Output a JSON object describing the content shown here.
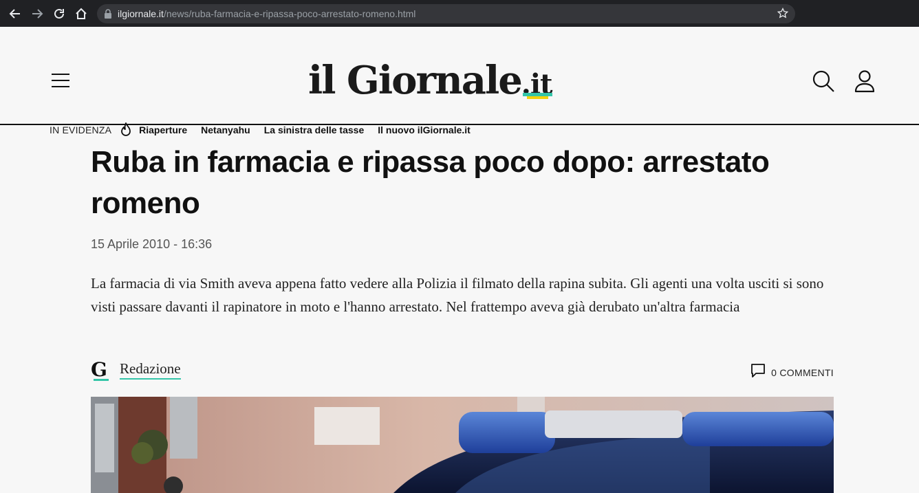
{
  "browser": {
    "url_host": "ilgiornale.it",
    "url_path": "/news/ruba-farmacia-e-ripassa-poco-arrestato-romeno.html"
  },
  "header": {
    "logo_main": "il Giornale",
    "logo_tld": ".it",
    "evidenza_label": "IN EVIDENZA",
    "evidenza_links": [
      "Riaperture",
      "Netanyahu",
      "La sinistra delle tasse",
      "Il nuovo ilGiornale.it"
    ]
  },
  "article": {
    "title": "Ruba in farmacia e ripassa poco dopo: arrestato romeno",
    "date": "15 Aprile 2010 - 16:36",
    "lead": "La farmacia di via Smith aveva appena fatto vedere alla Polizia il filmato della rapina subita. Gli agenti una volta usciti si sono visti passare davanti il rapinatore in moto e l'hanno arrestato. Nel frattempo aveva già derubato un'altra farmacia",
    "author_initial": "G",
    "author": "Redazione",
    "comments": "0 COMMENTI"
  },
  "colors": {
    "accent": "#33c5a8",
    "accent_yellow": "#f4d10b",
    "text": "#111111",
    "background": "#f7f7f7"
  },
  "icons": [
    "back-icon",
    "forward-icon",
    "reload-icon",
    "home-icon",
    "lock-icon",
    "star-icon",
    "menu-icon",
    "search-icon",
    "user-icon",
    "flame-icon",
    "comment-icon"
  ]
}
